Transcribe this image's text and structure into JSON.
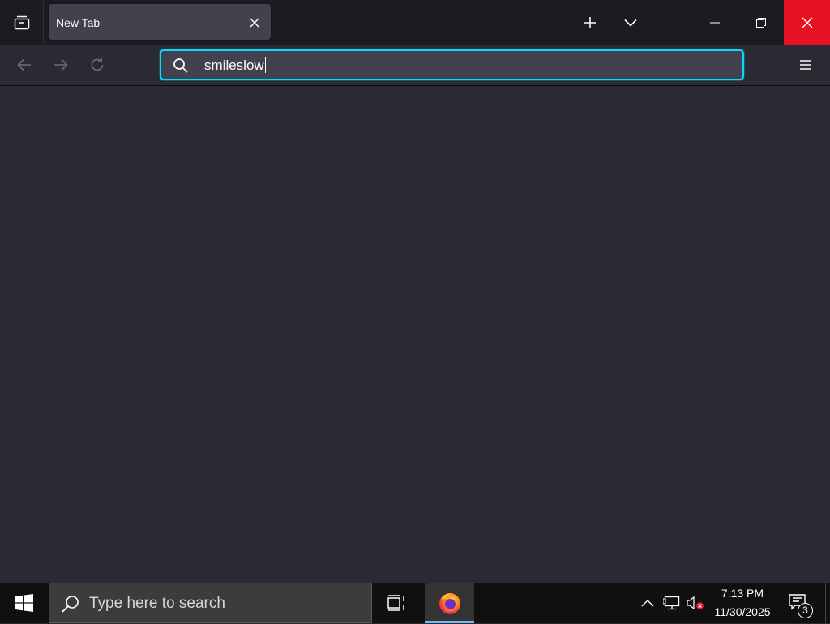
{
  "browser": {
    "tab": {
      "title": "New Tab",
      "close_icon": "close-icon"
    },
    "icons": {
      "tab_manager": "list-all-tabs-icon",
      "new_tab": "plus-icon",
      "tab_list": "chevron-down-icon",
      "minimize": "minimize-icon",
      "restore": "restore-icon",
      "close": "close-icon",
      "back": "arrow-left-icon",
      "forward": "arrow-right-icon",
      "reload": "reload-icon",
      "search": "search-icon",
      "menu": "hamburger-menu-icon"
    },
    "urlbar": {
      "value": "smileslow"
    },
    "colors": {
      "toolbar": "#2b2a33",
      "tabstrip": "#1c1b22",
      "tab_selected": "#42414d",
      "focus_ring": "#00ddff",
      "close_hover": "#e81123"
    }
  },
  "taskbar": {
    "search": {
      "placeholder": "Type here to search"
    },
    "clock": {
      "time": "7:13 PM",
      "date": "11/30/2025"
    },
    "notification_count": "3",
    "icons": {
      "start": "windows-logo-icon",
      "search": "search-icon",
      "task_view": "task-view-icon",
      "firefox": "firefox-icon",
      "tray_overflow": "chevron-up-icon",
      "network": "network-icon",
      "volume": "volume-muted-icon",
      "action_center": "notification-icon"
    }
  }
}
